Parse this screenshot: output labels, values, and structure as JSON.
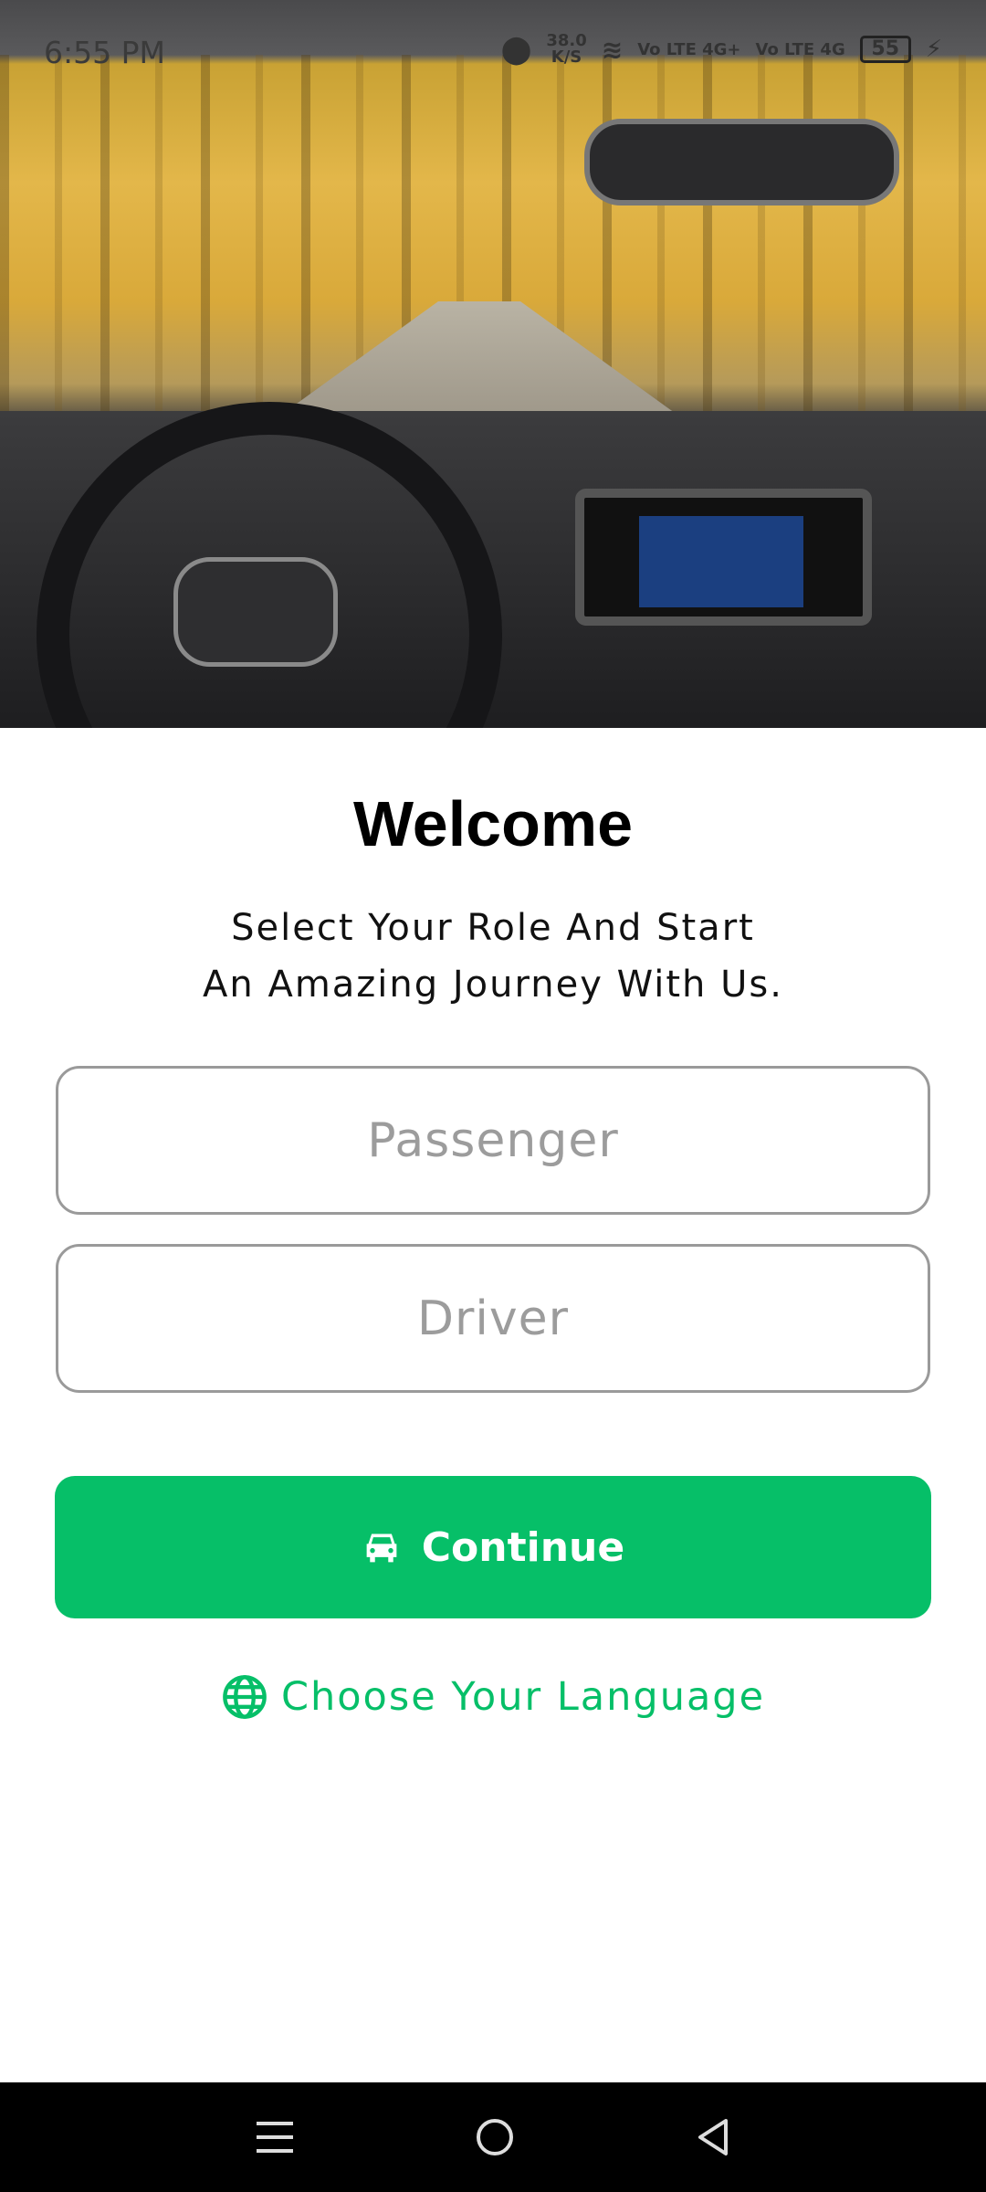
{
  "status_bar": {
    "time": "6:55 PM",
    "net_speed": "38.0",
    "net_unit": "K/S",
    "sim1": "Vo LTE 4G+",
    "sim2": "Vo LTE 4G",
    "battery": "55"
  },
  "hero": {
    "image": "car-interior-autumn-road"
  },
  "welcome": {
    "title": "Welcome",
    "subtitle_line1": "Select Your Role And Start",
    "subtitle_line2": "An Amazing Journey With Us."
  },
  "roles": [
    {
      "label": "Passenger",
      "selected": false
    },
    {
      "label": "Driver",
      "selected": false
    }
  ],
  "continue": {
    "label": "Continue",
    "icon": "car-icon"
  },
  "language": {
    "label": "Choose Your Language",
    "icon": "globe-icon"
  },
  "colors": {
    "accent": "#06BF68"
  },
  "nav": {
    "icons": [
      "menu-icon",
      "home-icon",
      "back-icon"
    ]
  }
}
